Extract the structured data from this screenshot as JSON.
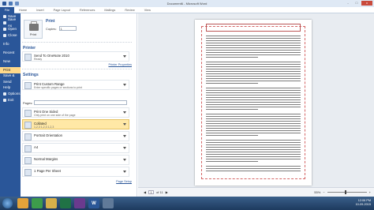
{
  "window": {
    "title": "Document6 - Microsoft Word",
    "controls": {
      "minimize": "-",
      "maximize": "□",
      "close": "x"
    }
  },
  "ribbon": {
    "file_tab": "File",
    "tabs": [
      "Home",
      "Insert",
      "Page Layout",
      "References",
      "Mailings",
      "Review",
      "View"
    ]
  },
  "backstage_menu": [
    {
      "label": "Save",
      "icon": "save-icon"
    },
    {
      "label": "Save As",
      "icon": "save-as-icon"
    },
    {
      "label": "Open",
      "icon": "folder-icon"
    },
    {
      "label": "Close",
      "icon": "close-icon"
    },
    {
      "label": "Info",
      "icon": ""
    },
    {
      "label": "Recent",
      "icon": ""
    },
    {
      "label": "New",
      "icon": ""
    },
    {
      "label": "Print",
      "icon": "",
      "selected": true
    },
    {
      "label": "Save & Send",
      "icon": ""
    },
    {
      "label": "Help",
      "icon": ""
    },
    {
      "label": "Options",
      "icon": "options-icon"
    },
    {
      "label": "Exit",
      "icon": "exit-icon"
    }
  ],
  "print": {
    "section_title": "Print",
    "button_label": "Print",
    "copies_label": "Copies:",
    "copies_value": "1"
  },
  "printer": {
    "section_title": "Printer",
    "name": "Send To OneNote 2010",
    "status": "Ready",
    "properties_link": "Printer Properties"
  },
  "settings": {
    "section_title": "Settings",
    "items": [
      {
        "title": "Print Custom Range",
        "subtitle": "Enter specific pages or sections to print"
      },
      {
        "title": "Print One Sided",
        "subtitle": "Only print on one side of the page"
      },
      {
        "title": "Collated",
        "subtitle": "1,2,3   1,2,3   1,2,3",
        "highlighted": true
      },
      {
        "title": "Portrait Orientation",
        "subtitle": ""
      },
      {
        "title": "A4",
        "subtitle": ""
      },
      {
        "title": "Normal Margins",
        "subtitle": ""
      },
      {
        "title": "1 Page Per Sheet",
        "subtitle": ""
      }
    ],
    "pages_label": "Pages:",
    "pages_value": "",
    "page_setup_link": "Page Setup"
  },
  "preview_nav": {
    "current_page": "1",
    "of_text": "of 11",
    "zoom": "55%"
  },
  "taskbar": {
    "apps": [
      {
        "name": "explorer",
        "color": "#e3a33a"
      },
      {
        "name": "chrome",
        "color": "#3d9c4b"
      },
      {
        "name": "windows-explorer",
        "color": "#d7b04a"
      },
      {
        "name": "excel",
        "color": "#207245"
      },
      {
        "name": "winrar",
        "color": "#6b3a8e"
      },
      {
        "name": "word",
        "color": "#2b5797",
        "glyph": "W"
      },
      {
        "name": "misc",
        "color": "#607a99"
      }
    ],
    "clock_time": "12:06 PM",
    "clock_date": "10-09-2015"
  }
}
